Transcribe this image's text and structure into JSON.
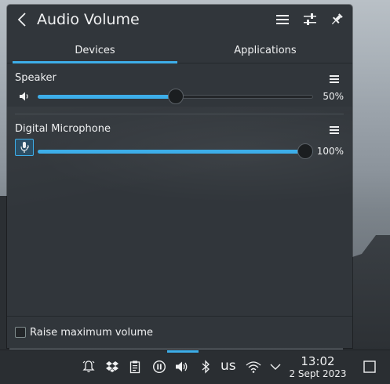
{
  "popup": {
    "title": "Audio Volume",
    "icons": {
      "back": "chevron-left-icon",
      "menu": "hamburger-menu-icon",
      "configure": "configure-sliders-icon",
      "pin": "pin-icon"
    }
  },
  "tabs": [
    {
      "label": "Devices",
      "active": true
    },
    {
      "label": "Applications",
      "active": false
    }
  ],
  "devices": [
    {
      "name": "Speaker",
      "icon": "speaker-icon",
      "volume_percent": 50,
      "volume_label": "50%"
    },
    {
      "name": "Digital Microphone",
      "icon": "microphone-icon",
      "volume_percent": 100,
      "volume_label": "100%"
    }
  ],
  "footer": {
    "raise_label": "Raise maximum volume",
    "raise_checked": false
  },
  "taskbar": {
    "tray_icons": [
      "notification-bell-icon",
      "dropbox-icon",
      "clipboard-icon",
      "media-pause-icon",
      "volume-icon",
      "bluetooth-icon",
      "network-wifi-icon",
      "expand-tray-icon",
      "show-desktop-icon"
    ],
    "keyboard_layout": "us",
    "time": "13:02",
    "date": "2 Sept 2023"
  },
  "colors": {
    "accent": "#3daee9",
    "panel_bg": "#31363b",
    "text": "#eff0f1"
  }
}
